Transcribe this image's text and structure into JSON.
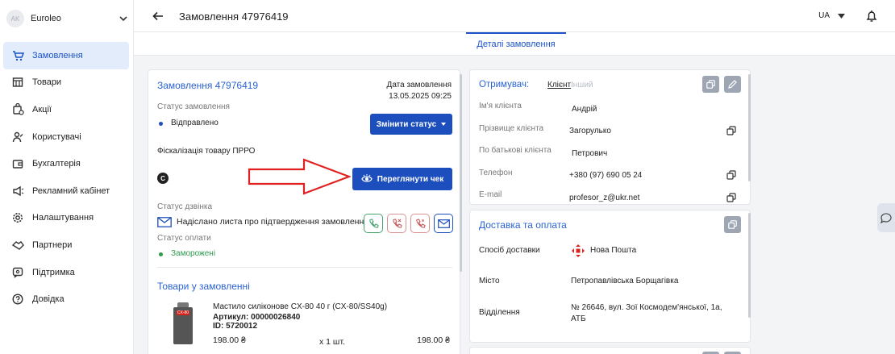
{
  "store": {
    "avatar_initials": "AK",
    "name": "Euroleo"
  },
  "nav": [
    {
      "label": "Замовлення",
      "icon": "cart-icon",
      "active": true
    },
    {
      "label": "Товари",
      "icon": "store-icon"
    },
    {
      "label": "Акції",
      "icon": "promo-icon"
    },
    {
      "label": "Користувачі",
      "icon": "users-icon"
    },
    {
      "label": "Бухгалтерія",
      "icon": "wallet-icon"
    },
    {
      "label": "Рекламний кабінет",
      "icon": "megaphone-icon"
    },
    {
      "label": "Налаштування",
      "icon": "gear-icon"
    },
    {
      "label": "Партнери",
      "icon": "handshake-icon"
    },
    {
      "label": "Підтримка",
      "icon": "support-icon"
    },
    {
      "label": "Довідка",
      "icon": "help-icon"
    }
  ],
  "header": {
    "title": "Замовлення 47976419",
    "lang": "UA"
  },
  "tabs": {
    "details": "Деталі замовлення"
  },
  "order": {
    "title": "Замовлення 47976419",
    "date_label": "Дата замовлення",
    "date_value": "13.05.2025 09:25",
    "status_label": "Статус замовлення",
    "status_value": "Відправлено",
    "change_status": "Змінити статус",
    "fiscal_label": "Фіскалізація товару ПРРО",
    "fiscal_badge": "C",
    "view_receipt": "Переглянути чек",
    "call_status_label": "Статус дзвінка",
    "call_status_value": "Надіслано листа про підтвердження замовлення",
    "payment_status_label": "Статус оплати",
    "payment_status_value": "Заморожені",
    "items_title": "Товари у замовленні",
    "item": {
      "name": "Мастило силіконове CX-80 40 г (CX-80/SS40g)",
      "sku": "Артикул: 00000026840",
      "id": "ID: 5720012",
      "price": "198.00 ₴",
      "qty": "x 1 шт.",
      "total": "198.00 ₴",
      "image_text": "CX-80"
    }
  },
  "recipient": {
    "label": "Отримувач:",
    "tab_client": "Клієнт",
    "tab_other": "Інший",
    "rows": [
      {
        "label": "Ім'я клієнта",
        "value": "Андрій"
      },
      {
        "label": "Прізвище клієнта",
        "value": "Загорулько"
      },
      {
        "label": "По батькові клієнта",
        "value": "Петрович"
      },
      {
        "label": "Телефон",
        "value": "+380 (97) 690 05 24"
      },
      {
        "label": "E-mail",
        "value": "profesor_z@ukr.net"
      }
    ]
  },
  "delivery": {
    "title": "Доставка та оплата",
    "method_label": "Спосіб доставки",
    "method_value": "Нова Пошта",
    "city_label": "Місто",
    "city_value": "Петропавлівська Борщагівка",
    "branch_label": "Відділення",
    "branch_value_line1": "№ 26646, вул. Зої Космодем'янської, 1а,",
    "branch_value_line2": "АТБ"
  },
  "colors": {
    "primary": "#1c4fbd",
    "link": "#2a63d4",
    "success": "#2e9a4e",
    "annotation": "#e02020"
  }
}
